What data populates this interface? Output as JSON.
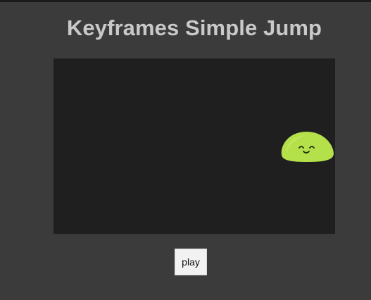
{
  "title": "Keyframes Simple Jump",
  "controls": {
    "play_label": "play"
  },
  "stage": {
    "character": "slime",
    "character_color": "#b4e04a",
    "background_color": "#1f1f1f"
  },
  "colors": {
    "page_background": "#3b3b3b",
    "title_text": "#c9c9c9",
    "button_background": "#f2f2f2"
  }
}
